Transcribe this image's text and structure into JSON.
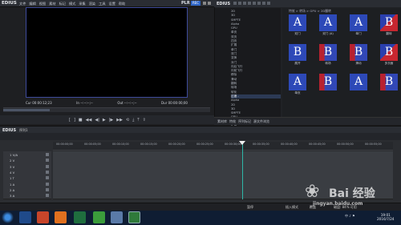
{
  "app": {
    "title": "EDIUS",
    "plr": "PLR",
    "rec": "REC"
  },
  "menubar": {
    "items": [
      "文件",
      "编辑",
      "视图",
      "素材",
      "标记",
      "模式",
      "采集",
      "渲染",
      "工具",
      "设置",
      "帮助"
    ]
  },
  "player": {
    "timecodes": {
      "cur": "Cur 00:00:12;23",
      "in": "In --:--:--;--",
      "out": "Out --:--:--;--",
      "dur": "Dur 00:00:00;00"
    }
  },
  "bin": {
    "title": "EDIUS",
    "path": "特效 > 转场 > GPU > 2D翻转",
    "tree_items": [
      "2D",
      "3D",
      "SMPTE",
      "Alpha",
      "GPU",
      "单页",
      "双页",
      "四页",
      "扩展",
      "单门",
      "双门",
      "变换",
      "对门",
      "向后飞行",
      "向前飞行",
      "移除",
      "滑动",
      "翻转",
      "转场",
      "软化",
      "过渡 -",
      "Alpha",
      "2D",
      "3D",
      "SMPTE",
      "GPU",
      "双页",
      "扩展",
      "四页",
      "旋转",
      "旋转 (3)",
      "可变形",
      "交叉",
      "立方体",
      "移动",
      "单页",
      "溶化",
      "滑动",
      "双向",
      "旋转管状",
      "翻转",
      "转场",
      "爆炸",
      "滑翔",
      "双面",
      "球体",
      "标准"
    ],
    "selected_index": 20,
    "thumbs": [
      {
        "letter": "A",
        "cap": "双门",
        "style": "a"
      },
      {
        "letter": "A",
        "cap": "双门 (A)",
        "style": "a"
      },
      {
        "letter": "A",
        "cap": "单门",
        "style": "a"
      },
      {
        "letter": "B",
        "cap": "翻转",
        "style": "b"
      },
      {
        "letter": "B",
        "cap": "展开",
        "style": "a"
      },
      {
        "letter": "B",
        "cap": "转场",
        "style": "c"
      },
      {
        "letter": "B",
        "cap": "滑动",
        "style": "c"
      },
      {
        "letter": "B",
        "cap": "多页面",
        "style": "b"
      },
      {
        "letter": "A",
        "cap": "单页",
        "style": "a"
      },
      {
        "letter": "B",
        "cap": "",
        "style": "c"
      },
      {
        "letter": "A",
        "cap": "",
        "style": "a"
      },
      {
        "letter": "B",
        "cap": "",
        "style": "c"
      }
    ],
    "tabs": [
      "素材库",
      "特效",
      "序列标记",
      "源文件浏览"
    ]
  },
  "timeline": {
    "title": "EDIUS",
    "sequence": "序列1",
    "ruler_ticks": [
      "00:00:00;00",
      "00:00:05;00",
      "00:00:10;00",
      "00:00:15;00",
      "00:00:20;00",
      "00:00:25;00",
      "00:00:30;00",
      "00:00:35;00",
      "00:00:40;00",
      "00:00:45;00",
      "00:00:50;00",
      "00:00:55;00"
    ],
    "tracks": [
      "1 V/A",
      "2 V",
      "3 V",
      "4 V",
      "1 T",
      "1 A",
      "2 A",
      "3 A"
    ]
  },
  "status": {
    "mode": "暂停",
    "ins": "插入模式",
    "ovr": "覆盖",
    "disk": "磁盘: 84% 可用"
  },
  "taskbar": {
    "clock_time": "19:01",
    "clock_date": "2016/7/24",
    "tray": "中 ♪ ⚑"
  },
  "watermark": {
    "brand": "Bai 经验",
    "url": "jingyan.baidu.com"
  }
}
